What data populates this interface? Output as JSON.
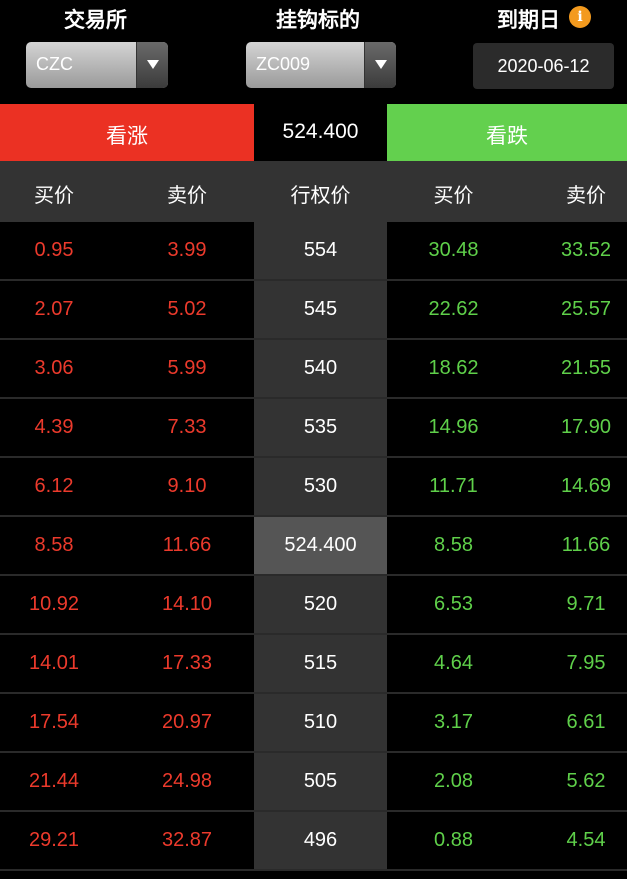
{
  "selectors": {
    "exchange": {
      "label": "交易所",
      "value": "CZC"
    },
    "underlying": {
      "label": "挂钩标的",
      "value": "ZC009"
    },
    "expiry": {
      "label": "到期日",
      "value": "2020-06-12"
    },
    "info_icon": "info-icon"
  },
  "bar": {
    "call_label": "看涨",
    "underlying_price": "524.400",
    "put_label": "看跌"
  },
  "header": {
    "call_bid": "买价",
    "call_ask": "卖价",
    "strike": "行权价",
    "put_bid": "买价",
    "put_ask": "卖价"
  },
  "colors": {
    "call": "#eb3123",
    "put": "#63d04e",
    "header_bg": "#333333",
    "strike_bg": "#333333",
    "atm_bg": "#555555",
    "info": "#f39a1e"
  },
  "rows": [
    {
      "call_bid": "0.95",
      "call_ask": "3.99",
      "strike": "554",
      "put_bid": "30.48",
      "put_ask": "33.52"
    },
    {
      "call_bid": "2.07",
      "call_ask": "5.02",
      "strike": "545",
      "put_bid": "22.62",
      "put_ask": "25.57"
    },
    {
      "call_bid": "3.06",
      "call_ask": "5.99",
      "strike": "540",
      "put_bid": "18.62",
      "put_ask": "21.55"
    },
    {
      "call_bid": "4.39",
      "call_ask": "7.33",
      "strike": "535",
      "put_bid": "14.96",
      "put_ask": "17.90"
    },
    {
      "call_bid": "6.12",
      "call_ask": "9.10",
      "strike": "530",
      "put_bid": "11.71",
      "put_ask": "14.69"
    },
    {
      "call_bid": "8.58",
      "call_ask": "11.66",
      "strike": "524.400",
      "put_bid": "8.58",
      "put_ask": "11.66",
      "atm": true
    },
    {
      "call_bid": "10.92",
      "call_ask": "14.10",
      "strike": "520",
      "put_bid": "6.53",
      "put_ask": "9.71"
    },
    {
      "call_bid": "14.01",
      "call_ask": "17.33",
      "strike": "515",
      "put_bid": "4.64",
      "put_ask": "7.95"
    },
    {
      "call_bid": "17.54",
      "call_ask": "20.97",
      "strike": "510",
      "put_bid": "3.17",
      "put_ask": "6.61"
    },
    {
      "call_bid": "21.44",
      "call_ask": "24.98",
      "strike": "505",
      "put_bid": "2.08",
      "put_ask": "5.62"
    },
    {
      "call_bid": "29.21",
      "call_ask": "32.87",
      "strike": "496",
      "put_bid": "0.88",
      "put_ask": "4.54"
    }
  ]
}
